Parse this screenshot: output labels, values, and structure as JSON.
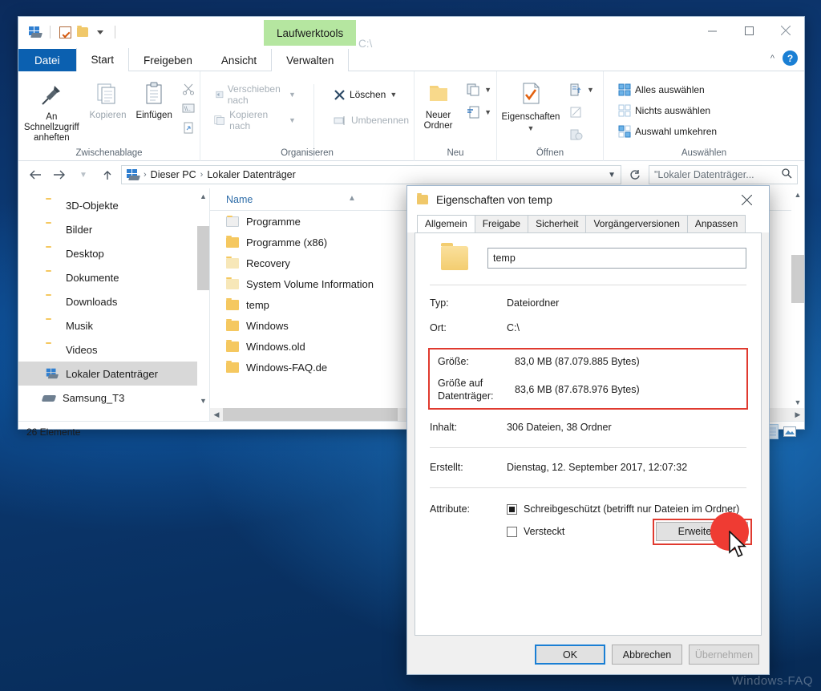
{
  "desktop": {
    "watermark": "Windows-FAQ"
  },
  "explorer": {
    "quick_access": {
      "items": [
        "windows-drive-icon",
        "properties-check-icon",
        "new-folder-icon",
        "customize-caret-icon"
      ]
    },
    "context_tab": "Laufwerktools",
    "window_title": "C:\\",
    "window_controls": {
      "minimize": "minimize-icon",
      "maximize": "maximize-icon",
      "close": "close-icon",
      "collapse_ribbon": "chevron-up-icon",
      "help": "?"
    },
    "tabs": [
      {
        "label": "Datei",
        "state": "file"
      },
      {
        "label": "Start",
        "state": "active"
      },
      {
        "label": "Freigeben",
        "state": "normal"
      },
      {
        "label": "Ansicht",
        "state": "normal"
      },
      {
        "label": "Verwalten",
        "state": "context"
      }
    ],
    "ribbon": {
      "groups": [
        {
          "name": "Zwischenablage",
          "big": [
            {
              "label": "An Schnellzugriff anheften",
              "icon": "pin-icon",
              "dim": false
            },
            {
              "label": "Kopieren",
              "icon": "copy-icon",
              "dim": true
            },
            {
              "label": "Einfügen",
              "icon": "paste-icon",
              "dim": false
            }
          ],
          "small": [
            {
              "label": "",
              "icon": "scissors-icon",
              "dim": true
            },
            {
              "label": "",
              "icon": "copy-path-icon",
              "dim": true
            },
            {
              "label": "",
              "icon": "paste-shortcut-icon",
              "dim": true
            }
          ]
        },
        {
          "name": "Organisieren",
          "small": [
            {
              "label": "Verschieben nach",
              "icon": "move-to-icon",
              "dim": true,
              "caret": true
            },
            {
              "label": "Kopieren nach",
              "icon": "copy-to-icon",
              "dim": true,
              "caret": true
            },
            {
              "label": "Löschen",
              "icon": "delete-x-icon",
              "dim": false,
              "caret": true
            },
            {
              "label": "Umbenennen",
              "icon": "rename-icon",
              "dim": true,
              "caret": false
            }
          ]
        },
        {
          "name": "Neu",
          "big": [
            {
              "label": "Neuer Ordner",
              "icon": "new-folder-icon",
              "dim": false
            }
          ],
          "small": [
            {
              "label": "",
              "icon": "new-item-icon",
              "dim": false,
              "caret": true
            },
            {
              "label": "",
              "icon": "easy-access-icon",
              "dim": false,
              "caret": true
            }
          ]
        },
        {
          "name": "Öffnen",
          "big": [
            {
              "label": "Eigenschaften",
              "icon": "properties-icon",
              "dim": false,
              "caret": true
            }
          ],
          "small": [
            {
              "label": "",
              "icon": "open-with-icon",
              "dim": false,
              "caret": true
            },
            {
              "label": "",
              "icon": "edit-icon",
              "dim": true,
              "caret": false
            },
            {
              "label": "",
              "icon": "history-icon",
              "dim": true,
              "caret": false
            }
          ]
        },
        {
          "name": "Auswählen",
          "small": [
            {
              "label": "Alles auswählen",
              "icon": "select-all-icon",
              "dim": false
            },
            {
              "label": "Nichts auswählen",
              "icon": "select-none-icon",
              "dim": false
            },
            {
              "label": "Auswahl umkehren",
              "icon": "invert-selection-icon",
              "dim": false
            }
          ]
        }
      ]
    },
    "address": {
      "back": "back-arrow-icon",
      "forward": "forward-arrow-icon",
      "recent": "chevron-down-icon",
      "up": "up-arrow-icon",
      "breadcrumbs": [
        "Dieser PC",
        "Lokaler Datenträger"
      ],
      "history_caret": "chevron-down-icon",
      "refresh": "refresh-icon"
    },
    "search": {
      "value": "\"Lokaler Datenträger...",
      "icon": "search-icon"
    },
    "nav_pane": {
      "items": [
        {
          "label": "3D-Objekte",
          "selected": false
        },
        {
          "label": "Bilder",
          "selected": false
        },
        {
          "label": "Desktop",
          "selected": false
        },
        {
          "label": "Dokumente",
          "selected": false
        },
        {
          "label": "Downloads",
          "selected": false
        },
        {
          "label": "Musik",
          "selected": false
        },
        {
          "label": "Videos",
          "selected": false
        },
        {
          "label": "Lokaler Datenträger",
          "selected": true
        },
        {
          "label": "Samsung_T3",
          "selected": false
        }
      ]
    },
    "file_list": {
      "column_header": "Name",
      "sort_indicator": "sort-ascending-icon",
      "rows": [
        {
          "name": "Programme",
          "icon": "folder-shortcut-icon"
        },
        {
          "name": "Programme (x86)",
          "icon": "folder-icon"
        },
        {
          "name": "Recovery",
          "icon": "folder-dim-icon"
        },
        {
          "name": "System Volume Information",
          "icon": "folder-dim-icon"
        },
        {
          "name": "temp",
          "icon": "folder-icon"
        },
        {
          "name": "Windows",
          "icon": "folder-icon"
        },
        {
          "name": "Windows.old",
          "icon": "folder-icon"
        },
        {
          "name": "Windows-FAQ.de",
          "icon": "folder-icon"
        }
      ]
    },
    "status_bar": {
      "item_count": "26 Elemente",
      "view_details": "details-view-icon",
      "view_large": "large-icons-view-icon"
    }
  },
  "dialog": {
    "title": "Eigenschaften von temp",
    "title_icon": "folder-icon",
    "close": "close-icon",
    "tabs": [
      {
        "label": "Allgemein",
        "active": true
      },
      {
        "label": "Freigabe",
        "active": false
      },
      {
        "label": "Sicherheit",
        "active": false
      },
      {
        "label": "Vorgängerversionen",
        "active": false
      },
      {
        "label": "Anpassen",
        "active": false
      }
    ],
    "name_value": "temp",
    "rows": [
      {
        "label": "Typ:",
        "value": "Dateiordner"
      },
      {
        "label": "Ort:",
        "value": "C:\\"
      }
    ],
    "size_rows": [
      {
        "label": "Größe:",
        "value": "83,0 MB (87.079.885 Bytes)"
      },
      {
        "label": "Größe auf Datenträger:",
        "value": "83,6 MB (87.678.976 Bytes)"
      }
    ],
    "content_row": {
      "label": "Inhalt:",
      "value": "306 Dateien, 38 Ordner"
    },
    "created_row": {
      "label": "Erstellt:",
      "value": "Dienstag, 12. September 2017, 12:07:32"
    },
    "attributes": {
      "label": "Attribute:",
      "readonly": {
        "label": "Schreibgeschützt (betrifft nur Dateien im Ordner)",
        "state": "partial"
      },
      "hidden": {
        "label": "Versteckt",
        "state": "unchecked"
      },
      "advanced_button": "Erweitert..."
    },
    "buttons": [
      {
        "label": "OK",
        "style": "primary"
      },
      {
        "label": "Abbrechen",
        "style": "normal"
      },
      {
        "label": "Übernehmen",
        "style": "disabled"
      }
    ],
    "highlight_color": "#e03a2f"
  }
}
